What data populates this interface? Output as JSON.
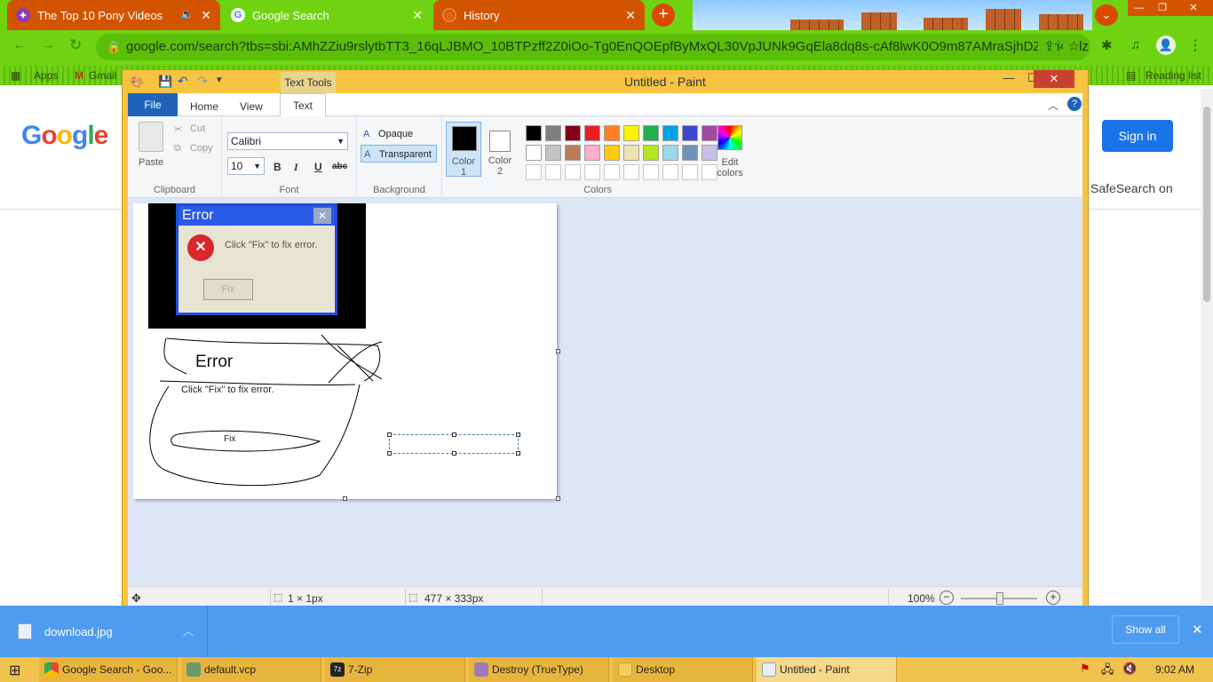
{
  "browser": {
    "tabs": [
      {
        "title": "The Top 10 Pony Videos",
        "audio_icon": "speaker-icon"
      },
      {
        "title": "Google Search"
      },
      {
        "title": "History"
      }
    ],
    "url": "google.com/search?tbs=sbi:AMhZZiu9rslytbTT3_16qLJBMO_10BTPzff2Z0iOo-Tg0EnQOEpfByMxQL30VpJUNk9GqEla8dq8s-cAf8lwK0O9m87AMraSjhDZJrri4ddz7y_1...",
    "bookmarks": [
      "Apps",
      "Gmail"
    ],
    "reading_list": "Reading list"
  },
  "google": {
    "logo": "Google",
    "sign_in": "Sign in",
    "safesearch": "SafeSearch on"
  },
  "paint": {
    "title": "Untitled - Paint",
    "contextual_tab": "Text Tools",
    "tabs": [
      "File",
      "Home",
      "View",
      "Text"
    ],
    "clipboard": {
      "paste": "Paste",
      "cut": "Cut",
      "copy": "Copy",
      "label": "Clipboard"
    },
    "font": {
      "name": "Calibri",
      "size": "10",
      "bold": "B",
      "italic": "I",
      "underline": "U",
      "strike": "abc",
      "label": "Font"
    },
    "background": {
      "opaque": "Opaque",
      "transparent": "Transparent",
      "label": "Background"
    },
    "colors": {
      "color1": "Color 1",
      "color2": "Color 2",
      "edit": "Edit colors",
      "label": "Colors",
      "palette_row1": [
        "#000000",
        "#7f7f7f",
        "#880015",
        "#ed1c24",
        "#ff7f27",
        "#fff200",
        "#22b14c",
        "#00a2e8",
        "#3f48cc",
        "#a349a4"
      ],
      "palette_row2": [
        "#ffffff",
        "#c3c3c3",
        "#b97a57",
        "#ffaec9",
        "#ffc90e",
        "#efe4b0",
        "#b5e61d",
        "#99d9ea",
        "#7092be",
        "#c8bfe7"
      ]
    },
    "drawing": {
      "dialog_title": "Error",
      "dialog_message": "Click \"Fix\" to fix error.",
      "dialog_button": "Fix",
      "sketch_title": "Error",
      "sketch_message": "Click \"Fix\" to fix error.",
      "sketch_button": "Fix"
    },
    "status": {
      "selection": "1 × 1px",
      "image_size": "477 × 333px",
      "zoom": "100%"
    }
  },
  "downloads": {
    "file": "download.jpg",
    "show_all": "Show all"
  },
  "taskbar": {
    "items": [
      "Google Search - Goo...",
      "default.vcp",
      "7-Zip",
      "Destroy (TrueType)",
      "Desktop",
      "Untitled - Paint"
    ],
    "clock": "9:02 AM"
  }
}
